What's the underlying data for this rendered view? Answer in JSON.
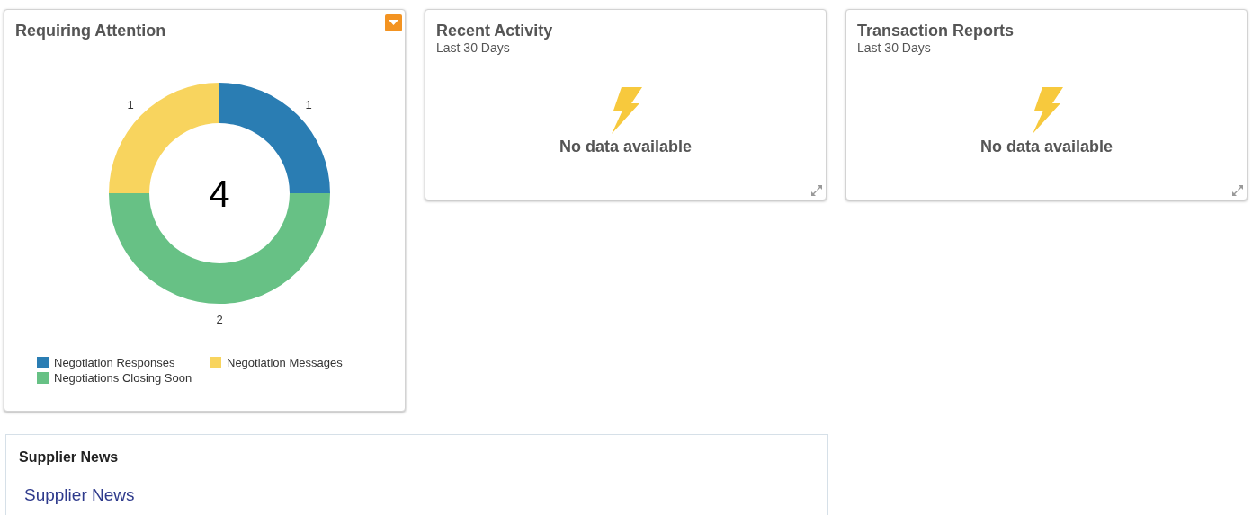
{
  "cards": [
    {
      "kind": "chart",
      "title": "Requiring Attention",
      "menu": true,
      "total": "4",
      "chart_data": {
        "type": "donut",
        "categories": [
          "Negotiation Responses",
          "Negotiation Messages",
          "Negotiations Closing Soon"
        ],
        "values": [
          1,
          1,
          2
        ],
        "colors": [
          "#2a7db3",
          "#f8d45e",
          "#67c185"
        ],
        "data_labels": true
      }
    },
    {
      "kind": "empty",
      "title": "Recent Activity",
      "subtitle": "Last 30 Days",
      "message": "No data available",
      "menu": false
    },
    {
      "kind": "empty",
      "title": "Transaction Reports",
      "subtitle": "Last 30 Days",
      "message": "No data available",
      "menu": false
    }
  ],
  "news": {
    "title": "Supplier News",
    "link": "Supplier News"
  }
}
